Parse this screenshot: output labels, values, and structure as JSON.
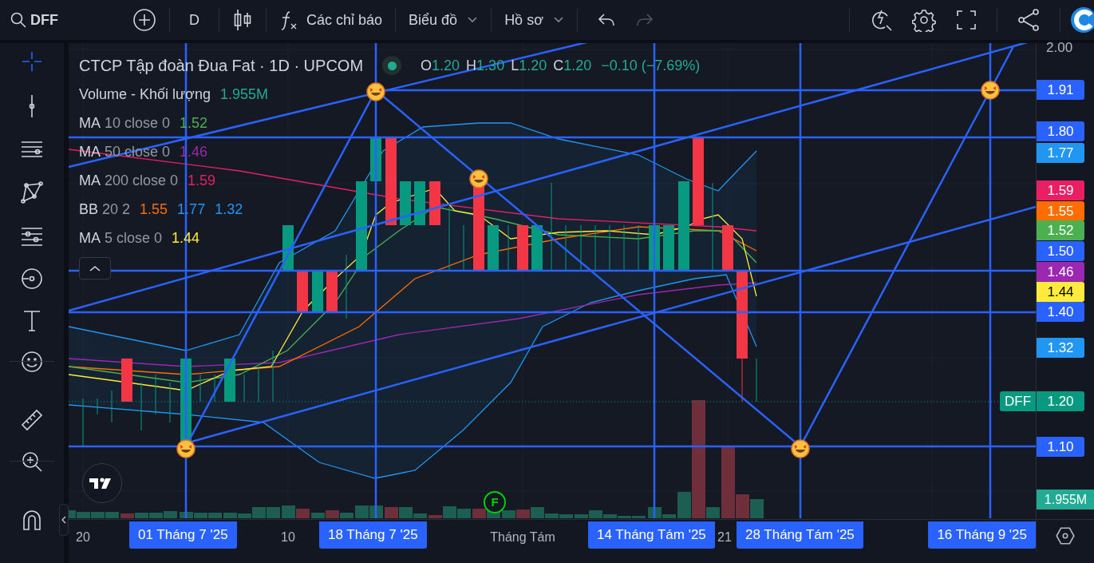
{
  "toolbar": {
    "symbol": "DFF",
    "interval": "D",
    "indicators_label": "Các chỉ báo",
    "menus": [
      {
        "label": "Biểu đồ"
      },
      {
        "label": "Hồ sơ"
      }
    ],
    "history": [
      {
        "kind": "undo",
        "disabled": false
      },
      {
        "kind": "redo",
        "disabled": true
      }
    ]
  },
  "drawing_tools": [
    {
      "kind": "crosshair",
      "selected": true
    },
    {
      "kind": "trend-line",
      "selected": false
    },
    {
      "kind": "parallel-lines",
      "selected": false
    },
    {
      "kind": "pattern",
      "selected": false
    },
    {
      "kind": "fibonacci",
      "selected": false
    },
    {
      "kind": "target",
      "selected": false
    },
    {
      "kind": "text",
      "selected": false
    },
    {
      "kind": "emoji",
      "selected": false
    },
    {
      "kind": "ruler",
      "selected": false
    },
    {
      "kind": "zoom",
      "selected": false
    },
    {
      "kind": "magnet",
      "selected": false
    }
  ],
  "legend": {
    "title": "CTCP Tập đoàn Đua Fat · 1D · UPCOM",
    "market_open": true,
    "ohlc": [
      {
        "label": "O",
        "value": "1.20"
      },
      {
        "label": "H",
        "value": "1.30"
      },
      {
        "label": "L",
        "value": "1.20"
      },
      {
        "label": "C",
        "value": "1.20"
      }
    ],
    "change": "−0.10 (−7.69%)",
    "indicators": [
      {
        "name": "Volume - Khối lượng",
        "values": [
          {
            "text": "1.955M",
            "color": "#22ab94"
          }
        ]
      },
      {
        "name": "MA",
        "params": "10 close 0",
        "values": [
          {
            "text": "1.52",
            "color": "#4caf50"
          }
        ]
      },
      {
        "name": "MA",
        "params": "50 close 0",
        "values": [
          {
            "text": "1.46",
            "color": "#9c27b0"
          }
        ]
      },
      {
        "name": "MA",
        "params": "200 close 0",
        "values": [
          {
            "text": "1.59",
            "color": "#e91e63"
          }
        ]
      },
      {
        "name": "BB",
        "params": "20 2",
        "values": [
          {
            "text": "1.55",
            "color": "#ff6d00"
          },
          {
            "text": "1.77",
            "color": "#2196f3"
          },
          {
            "text": "1.32",
            "color": "#2196f3"
          }
        ]
      },
      {
        "name": "MA",
        "params": "5 close 0",
        "values": [
          {
            "text": "1.44",
            "color": "#ffeb3b"
          }
        ]
      }
    ]
  },
  "event_marker": "F",
  "price_axis": {
    "ticks": [
      "2.00"
    ],
    "labels": [
      {
        "text": "1.91",
        "color": "#2962ff"
      },
      {
        "text": "1.80",
        "color": "#2962ff"
      },
      {
        "text": "1.77",
        "color": "#2196f3"
      },
      {
        "text": "1.59",
        "color": "#e91e63"
      },
      {
        "text": "1.55",
        "color": "#ff6d00"
      },
      {
        "text": "1.52",
        "color": "#4caf50"
      },
      {
        "text": "1.50",
        "color": "#2962ff"
      },
      {
        "text": "1.46",
        "color": "#9c27b0"
      },
      {
        "text": "1.44",
        "color": "#ffeb3b"
      },
      {
        "text": "1.40",
        "color": "#2962ff"
      },
      {
        "text": "1.32",
        "color": "#2196f3"
      },
      {
        "text": "1.20",
        "color": "#089981"
      },
      {
        "text": "1.10",
        "color": "#2962ff"
      }
    ],
    "symbol_label": "DFF",
    "volume_label": "1.955M"
  },
  "time_axis": {
    "ticks": [
      "20",
      "10",
      "Tháng Tám",
      "21"
    ],
    "labels": [
      "01 Tháng 7 '25",
      "18 Tháng 7 '25",
      "14 Tháng Tám '25",
      "28 Tháng Tám '25",
      "16 Tháng 9 '25"
    ]
  }
}
